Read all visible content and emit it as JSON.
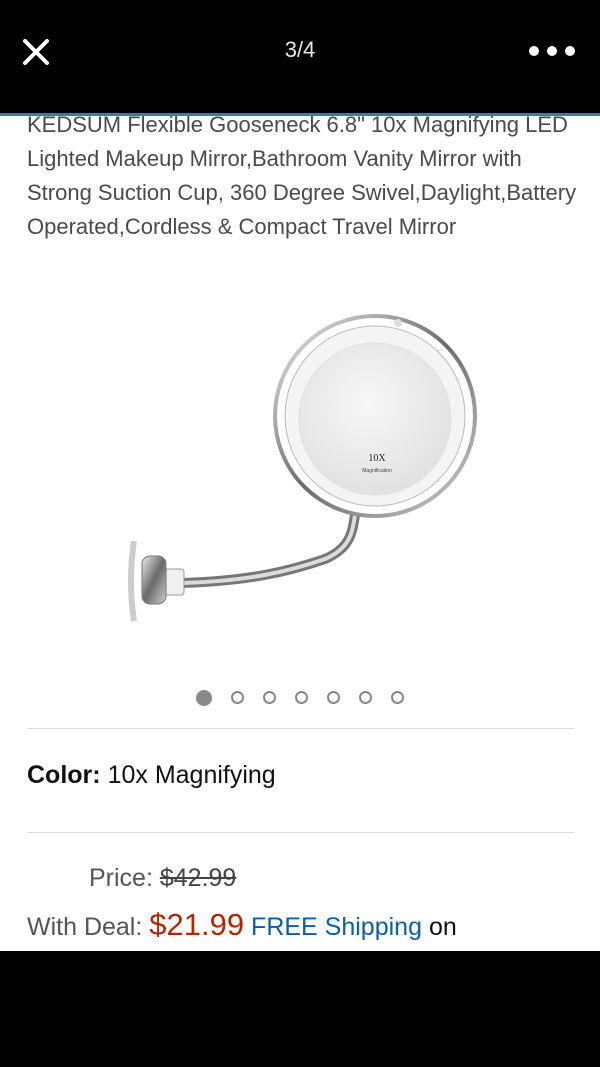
{
  "header": {
    "counter": "3/4"
  },
  "product": {
    "title": "KEDSUM Flexible Gooseneck 6.8\" 10x Magnifying LED Lighted Makeup Mirror,Bathroom Vanity Mirror with Strong Suction Cup, 360 Degree Swivel,Daylight,Battery Operated,Cordless & Compact Travel Mirror",
    "image_text": {
      "magnification": "10X",
      "caption": "Magnification"
    },
    "carousel": {
      "total": 7,
      "active": 0
    }
  },
  "options": {
    "color_label": "Color:",
    "color_value": "10x Magnifying"
  },
  "pricing": {
    "price_label": "Price:",
    "list_price": "$42.99",
    "deal_label": "With Deal:",
    "deal_price": "$21.99",
    "shipping": "FREE Shipping",
    "shipping_suffix": "on"
  },
  "colors": {
    "accent_line": "#2b84a8",
    "deal_price": "#b12704",
    "link": "#0a5fa8"
  }
}
